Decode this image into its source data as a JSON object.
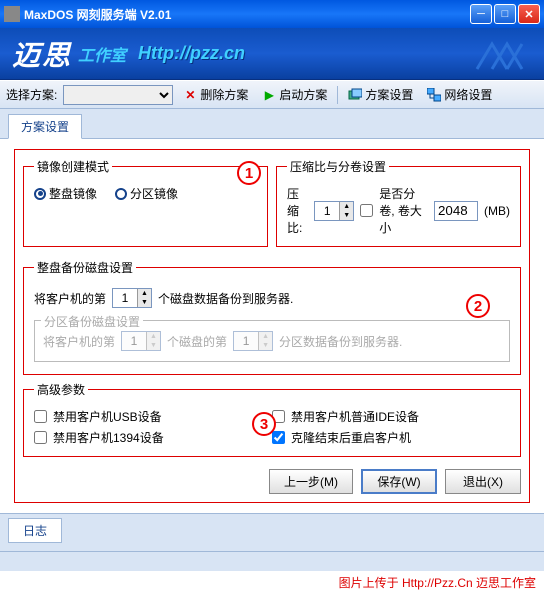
{
  "titlebar": {
    "text": "MaxDOS 网刻服务端 V2.01"
  },
  "banner": {
    "logo": "迈思",
    "sub": "工作室",
    "url": "Http://pzz.cn"
  },
  "toolbar": {
    "plan_label": "选择方案:",
    "delete": "删除方案",
    "start": "启动方案",
    "plan_settings": "方案设置",
    "net_settings": "网络设置"
  },
  "tab": {
    "active": "方案设置"
  },
  "annotations": {
    "n1": "1",
    "n2": "2",
    "n3": "3"
  },
  "mirror_mode": {
    "legend": "镜像创建模式",
    "full": "整盘镜像",
    "partition": "分区镜像"
  },
  "compress": {
    "legend": "压缩比与分卷设置",
    "ratio_label": "压缩比:",
    "ratio_value": "1",
    "split_label": "是否分卷, 卷大小",
    "size_value": "2048",
    "unit": "(MB)"
  },
  "fulldisk": {
    "legend": "整盘备份磁盘设置",
    "prefix": "将客户机的第",
    "value": "1",
    "suffix": "个磁盘数据备份到服务器."
  },
  "partition": {
    "legend": "分区备份磁盘设置",
    "prefix": "将客户机的第",
    "v1": "1",
    "mid": "个磁盘的第",
    "v2": "1",
    "suffix": "分区数据备份到服务器."
  },
  "advanced": {
    "legend": "高级参数",
    "usb": "禁用客户机USB设备",
    "ieee1394": "禁用客户机1394设备",
    "ide": "禁用客户机普通IDE设备",
    "reboot": "克隆结束后重启客户机"
  },
  "buttons": {
    "prev": "上一步(M)",
    "save": "保存(W)",
    "exit": "退出(X)"
  },
  "log": {
    "tab": "日志"
  },
  "footer": "图片上传于 Http://Pzz.Cn 迈思工作室"
}
